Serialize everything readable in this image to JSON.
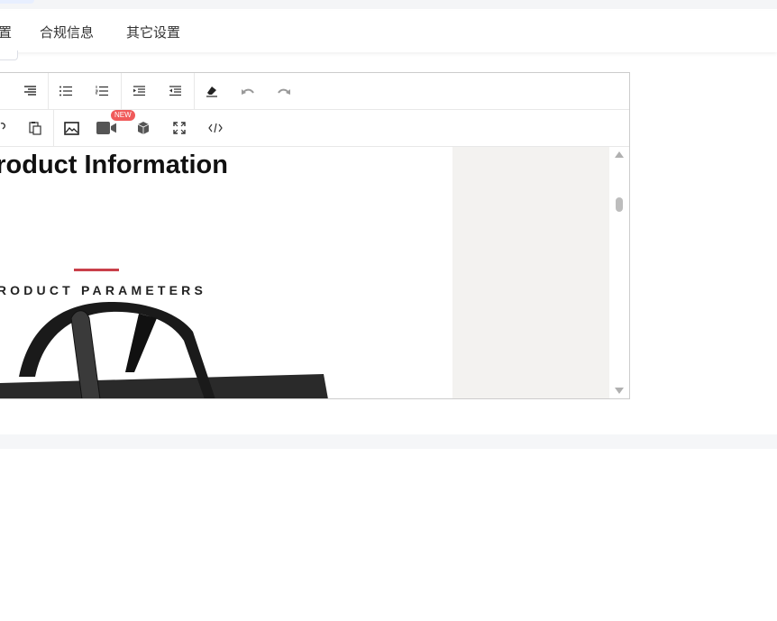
{
  "tabs": [
    {
      "label": "置"
    },
    {
      "label": "合规信息"
    },
    {
      "label": "其它设置"
    }
  ],
  "toolbar": {
    "row1": [
      "align-right-icon",
      "bullet-list-icon",
      "numbered-list-icon",
      "indent-icon",
      "outdent-icon",
      "eraser-icon",
      "undo-icon",
      "redo-icon"
    ],
    "row2": [
      "link-icon",
      "paste-icon",
      "image-icon",
      "video-icon",
      "3d-model-icon",
      "fullscreen-icon",
      "code-icon"
    ],
    "video_badge": "NEW"
  },
  "content": {
    "heading": "Product Information",
    "subheading": "PRODUCT PARAMETERS",
    "accent_color": "#c9404a"
  }
}
